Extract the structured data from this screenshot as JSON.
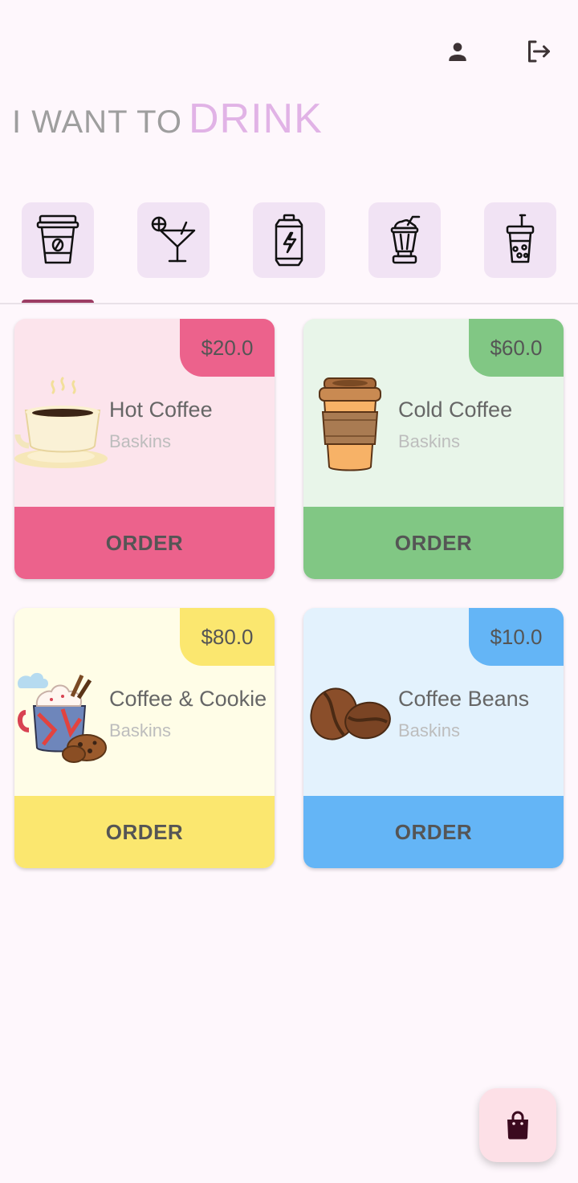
{
  "topbar": {
    "profile_icon": "person-icon",
    "logout_icon": "logout-icon"
  },
  "headline": {
    "prefix": "I WANT TO",
    "highlight": "DRINK"
  },
  "categories": [
    {
      "icon": "coffee-cup-icon",
      "selected": true
    },
    {
      "icon": "cocktail-icon",
      "selected": false
    },
    {
      "icon": "energy-drink-icon",
      "selected": false
    },
    {
      "icon": "milkshake-icon",
      "selected": false
    },
    {
      "icon": "bubble-tea-icon",
      "selected": false
    }
  ],
  "products": [
    {
      "name": "Hot Coffee",
      "brand": "Baskins",
      "price": "$20.0",
      "order_label": "ORDER",
      "icon": "hot-coffee-image",
      "colors": {
        "bg": "#fce4ec",
        "accent": "#ec628c"
      }
    },
    {
      "name": "Cold Coffee",
      "brand": "Baskins",
      "price": "$60.0",
      "order_label": "ORDER",
      "icon": "takeaway-coffee-image",
      "colors": {
        "bg": "#e8f5e9",
        "accent": "#81c784"
      }
    },
    {
      "name": "Coffee & Cookie",
      "brand": "Baskins",
      "price": "$80.0",
      "order_label": "ORDER",
      "icon": "coffee-cookie-image",
      "colors": {
        "bg": "#fffde7",
        "accent": "#fbe76f"
      }
    },
    {
      "name": "Coffee Beans",
      "brand": "Baskins",
      "price": "$10.0",
      "order_label": "ORDER",
      "icon": "coffee-beans-image",
      "colors": {
        "bg": "#e3f2fd",
        "accent": "#64b5f6"
      }
    }
  ],
  "fab": {
    "icon": "shopping-bag-icon"
  }
}
